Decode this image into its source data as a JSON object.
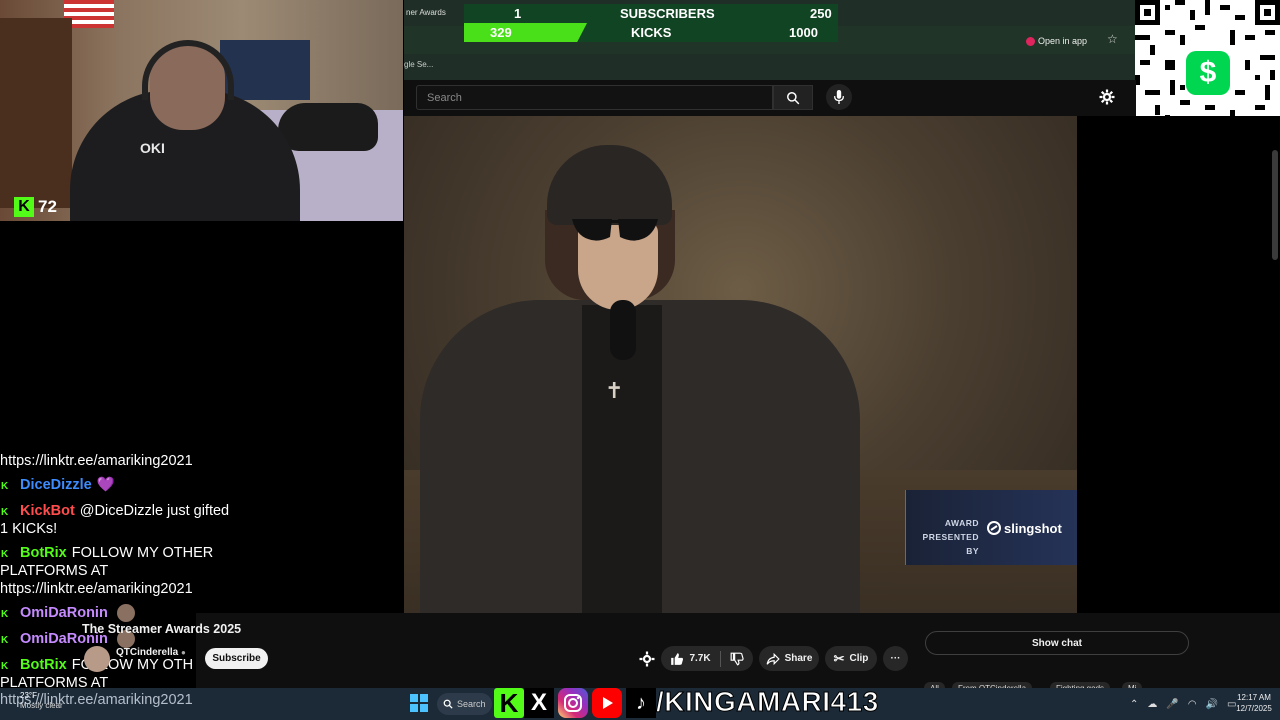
{
  "browser": {
    "tab_title": "ner Awards",
    "tab_close": "✕",
    "new_tab": "+",
    "open_in_app": "Open in app",
    "bookmark": "gle Se..."
  },
  "goals": {
    "subscribers": {
      "current": "1",
      "label": "SUBSCRIBERS",
      "goal": "250"
    },
    "kicks": {
      "current": "329",
      "label": "KICKS",
      "goal": "1000",
      "progress": 0.329
    }
  },
  "youtube": {
    "search_placeholder": "Search",
    "video_title": "The Streamer Awards 2025",
    "channel_name": "QTCinderella",
    "subscribe_label": "Subscribe",
    "likes": "7.7K",
    "share_label": "Share",
    "clip_label": "Clip",
    "more_label": "···",
    "show_chat_label": "Show chat",
    "chips": [
      "All",
      "From QTCinderella",
      "Fighting gods",
      "Mi"
    ],
    "award_presented_by": "AWARD PRESENTED BY",
    "sponsor": "slingshot"
  },
  "stream": {
    "viewer_count": "72",
    "hoodie_text": "OKI"
  },
  "chat": [
    {
      "text": "https://linktr.ee/amariking2021"
    },
    {
      "user": "DiceDizzle",
      "color": "blue",
      "message": "💜"
    },
    {
      "user": "KickBot",
      "color": "red",
      "message": "@DiceDizzle just gifted"
    },
    {
      "text": "1 KICKs!"
    },
    {
      "user": "BotRix",
      "color": "green",
      "message": "FOLLOW MY OTHER"
    },
    {
      "text": "PLATFORMS AT"
    },
    {
      "text": "https://linktr.ee/amariking2021"
    },
    {
      "user": "OmiDaRonin",
      "color": "purple",
      "message": ""
    },
    {
      "user": "OmiDaRonin",
      "color": "purple",
      "message": ""
    },
    {
      "user": "BotRix",
      "color": "green",
      "message": "FOLLOW MY OTH"
    },
    {
      "text": "PLATFORMS AT"
    }
  ],
  "overlay_url": "https://linktr.ee/amariking2021",
  "taskbar": {
    "weather_temp": "23°F",
    "weather_desc": "Mostly clear",
    "search_label": "Search",
    "social_handle": "/KINGAMARI413",
    "time": "12:17 AM",
    "date": "12/7/2025"
  },
  "qr": {
    "cashapp_symbol": "$"
  },
  "colors": {
    "kick_green": "#53fc18",
    "youtube_red": "#ff0000",
    "cashapp_green": "#00d64f"
  }
}
